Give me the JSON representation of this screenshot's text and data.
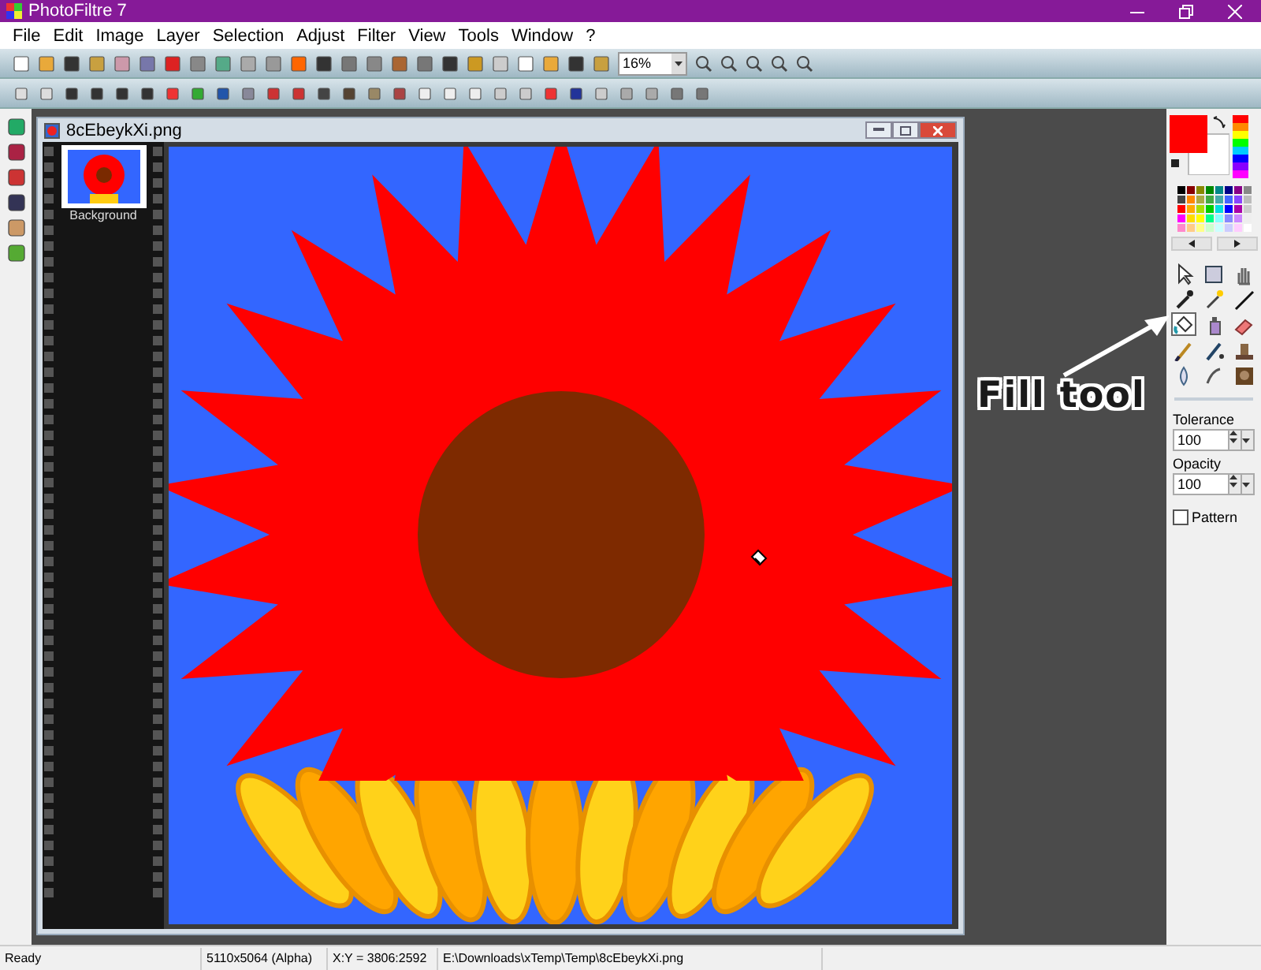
{
  "window": {
    "title": "PhotoFiltre 7"
  },
  "menu": [
    "File",
    "Edit",
    "Image",
    "Layer",
    "Selection",
    "Adjust",
    "Filter",
    "View",
    "Tools",
    "Window",
    "?"
  ],
  "zoom": {
    "value": "16%"
  },
  "image_window": {
    "title": "8cEbeykXi.png"
  },
  "layers": [
    {
      "name": "Background",
      "selected": true
    }
  ],
  "tools": [
    {
      "selected": false
    },
    {
      "selected": false
    },
    {
      "selected": false
    },
    {
      "selected": false
    },
    {
      "selected": false
    },
    {
      "selected": false
    },
    {
      "selected": true
    },
    {
      "selected": false
    },
    {
      "selected": false
    },
    {
      "selected": false
    },
    {
      "selected": false
    },
    {
      "selected": false
    },
    {
      "selected": false
    },
    {
      "selected": false
    },
    {
      "selected": false
    }
  ],
  "tolerance": {
    "label": "Tolerance",
    "value": "100"
  },
  "opacity": {
    "label": "Opacity",
    "value": "100"
  },
  "pattern": {
    "label": "Pattern",
    "checked": false
  },
  "annotation": {
    "text": "Fill tool"
  },
  "status_bar": [
    "Ready",
    "5110x5064 (Alpha)",
    "X:Y = 3806:2592",
    "E:\\Downloads\\xTemp\\Temp\\8cEbeykXi.png"
  ]
}
